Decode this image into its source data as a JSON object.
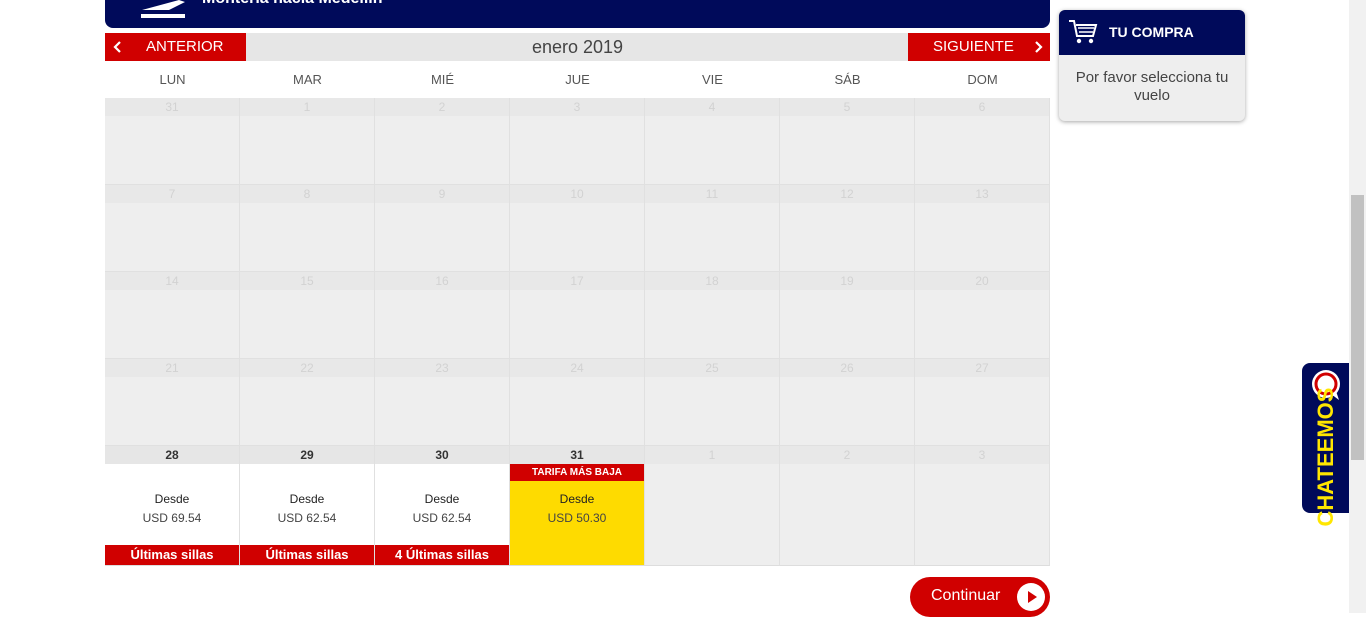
{
  "route": {
    "title": "Montería hacia Medellín"
  },
  "calendar": {
    "prev_label": "ANTERIOR",
    "next_label": "SIGUIENTE",
    "month_title": "enero 2019",
    "weekdays": [
      "LUN",
      "MAR",
      "MIÉ",
      "JUE",
      "VIE",
      "SÁB",
      "DOM"
    ],
    "weeks": [
      [
        "31",
        "1",
        "2",
        "3",
        "4",
        "5",
        "6"
      ],
      [
        "7",
        "8",
        "9",
        "10",
        "11",
        "12",
        "13"
      ],
      [
        "14",
        "15",
        "16",
        "17",
        "18",
        "19",
        "20"
      ],
      [
        "21",
        "22",
        "23",
        "24",
        "25",
        "26",
        "27"
      ]
    ],
    "last_week": [
      {
        "day": "28",
        "desde": "Desde",
        "price": "USD 69.54",
        "warning": "Últimas sillas"
      },
      {
        "day": "29",
        "desde": "Desde",
        "price": "USD 62.54",
        "warning": "Últimas sillas"
      },
      {
        "day": "30",
        "desde": "Desde",
        "price": "USD 62.54",
        "warning": "4 Últimas sillas"
      },
      {
        "day": "31",
        "tag": "TARIFA MÁS BAJA",
        "desde": "Desde",
        "price": "USD 50.30"
      },
      {
        "day": "1"
      },
      {
        "day": "2"
      },
      {
        "day": "3"
      }
    ]
  },
  "continue_label": "Continuar",
  "purchase": {
    "title": "TU COMPRA",
    "message": "Por favor selecciona tu vuelo"
  },
  "chat": {
    "label": "CHATEEMOS"
  },
  "colors": {
    "navy": "#000a5a",
    "red": "#d00000",
    "yellow": "#fedb00"
  }
}
